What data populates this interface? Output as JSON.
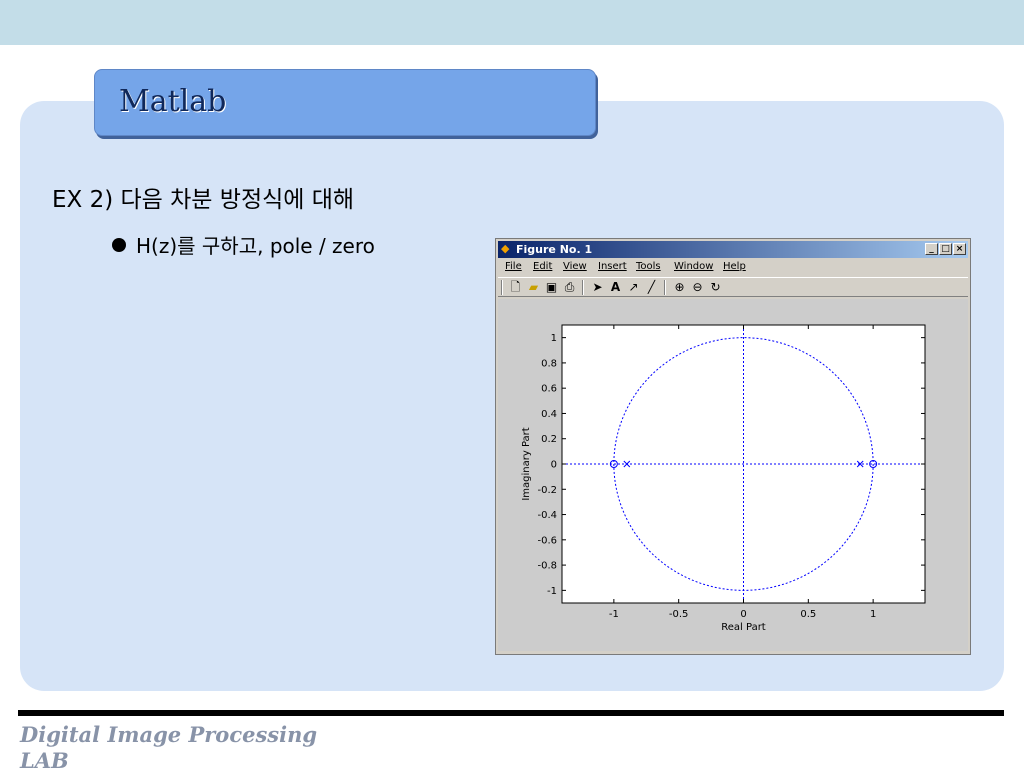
{
  "slide": {
    "title": "Matlab",
    "heading": "EX 2) 다음 차분 방정식에 대해",
    "bullet": "H(z)를 구하고, pole / zero",
    "footer_line1": "Digital Image Processing",
    "footer_line2": "LAB"
  },
  "figure_window": {
    "title": "Figure No. 1",
    "window_buttons": [
      "_",
      "□",
      "×"
    ],
    "menu": [
      "File",
      "Edit",
      "View",
      "Insert",
      "Tools",
      "Window",
      "Help"
    ],
    "toolbar_icons": [
      "new-file-icon",
      "open-folder-icon",
      "save-icon",
      "print-icon",
      "pointer-arrow-icon",
      "insert-text-icon",
      "insert-arrow-icon",
      "insert-line-icon",
      "zoom-in-icon",
      "zoom-out-icon",
      "rotate-3d-icon"
    ]
  },
  "chart_data": {
    "type": "scatter",
    "title": "",
    "xlabel": "Real Part",
    "ylabel": "Imaginary Part",
    "xlim": [
      -1.4,
      1.4
    ],
    "ylim": [
      -1.1,
      1.1
    ],
    "xticks": [
      -1,
      -0.5,
      0,
      0.5,
      1
    ],
    "xtick_labels": [
      "-1",
      "-0.5",
      "0",
      "0.5",
      "1"
    ],
    "yticks": [
      1,
      0.8,
      0.6,
      0.4,
      0.2,
      0,
      -0.2,
      -0.4,
      -0.6,
      -0.8,
      -1
    ],
    "ytick_labels": [
      "1",
      "0.8",
      "0.6",
      "0.4",
      "0.2",
      "0",
      "-0.2",
      "-0.4",
      "-0.6",
      "-0.8",
      "-1"
    ],
    "unit_circle": true,
    "zeros": [
      {
        "re": -1,
        "im": 0
      },
      {
        "re": 1,
        "im": 0
      }
    ],
    "poles": [
      {
        "re": -0.9,
        "im": 0
      },
      {
        "re": 0.9,
        "im": 0
      }
    ],
    "color": "#0000ff",
    "grid": false
  }
}
